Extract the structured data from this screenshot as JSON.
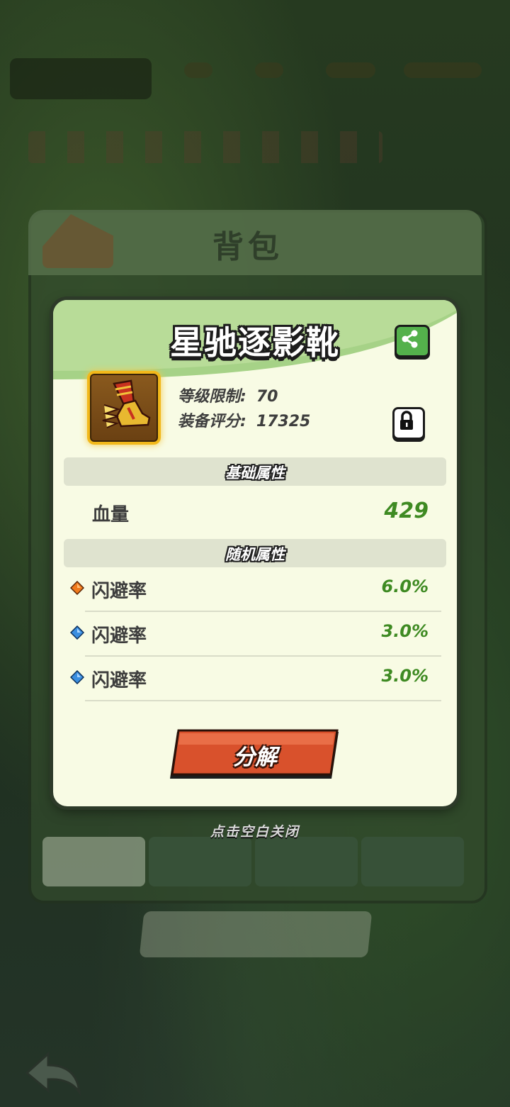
{
  "background": {
    "panel_title": "背包",
    "tabs": [
      "",
      "",
      "",
      ""
    ]
  },
  "item": {
    "name": "星驰逐影靴",
    "level_label": "等级限制:",
    "level_value": "70",
    "score_label": "装备评分:",
    "score_value": "17325",
    "icon": "golden-winged-boot-icon",
    "frame_color": "#f2b81a"
  },
  "base_section": {
    "title": "基础属性",
    "stats": [
      {
        "name": "血量",
        "value": "429"
      }
    ]
  },
  "random_section": {
    "title": "随机属性",
    "stats": [
      {
        "gem": "orange-gem-icon",
        "gem_color": "#f07a1c",
        "name": "闪避率",
        "value": "6.0%"
      },
      {
        "gem": "blue-gem-icon",
        "gem_color": "#3b8ee0",
        "name": "闪避率",
        "value": "3.0%"
      },
      {
        "gem": "blue-gem-icon",
        "gem_color": "#3b8ee0",
        "name": "闪避率",
        "value": "3.0%"
      }
    ]
  },
  "actions": {
    "decompose_label": "分解",
    "close_hint": "点击空白关闭"
  },
  "colors": {
    "stat_value": "#3e8a22",
    "header_green": "#9fcb7a",
    "button_red": "#d9512c"
  }
}
